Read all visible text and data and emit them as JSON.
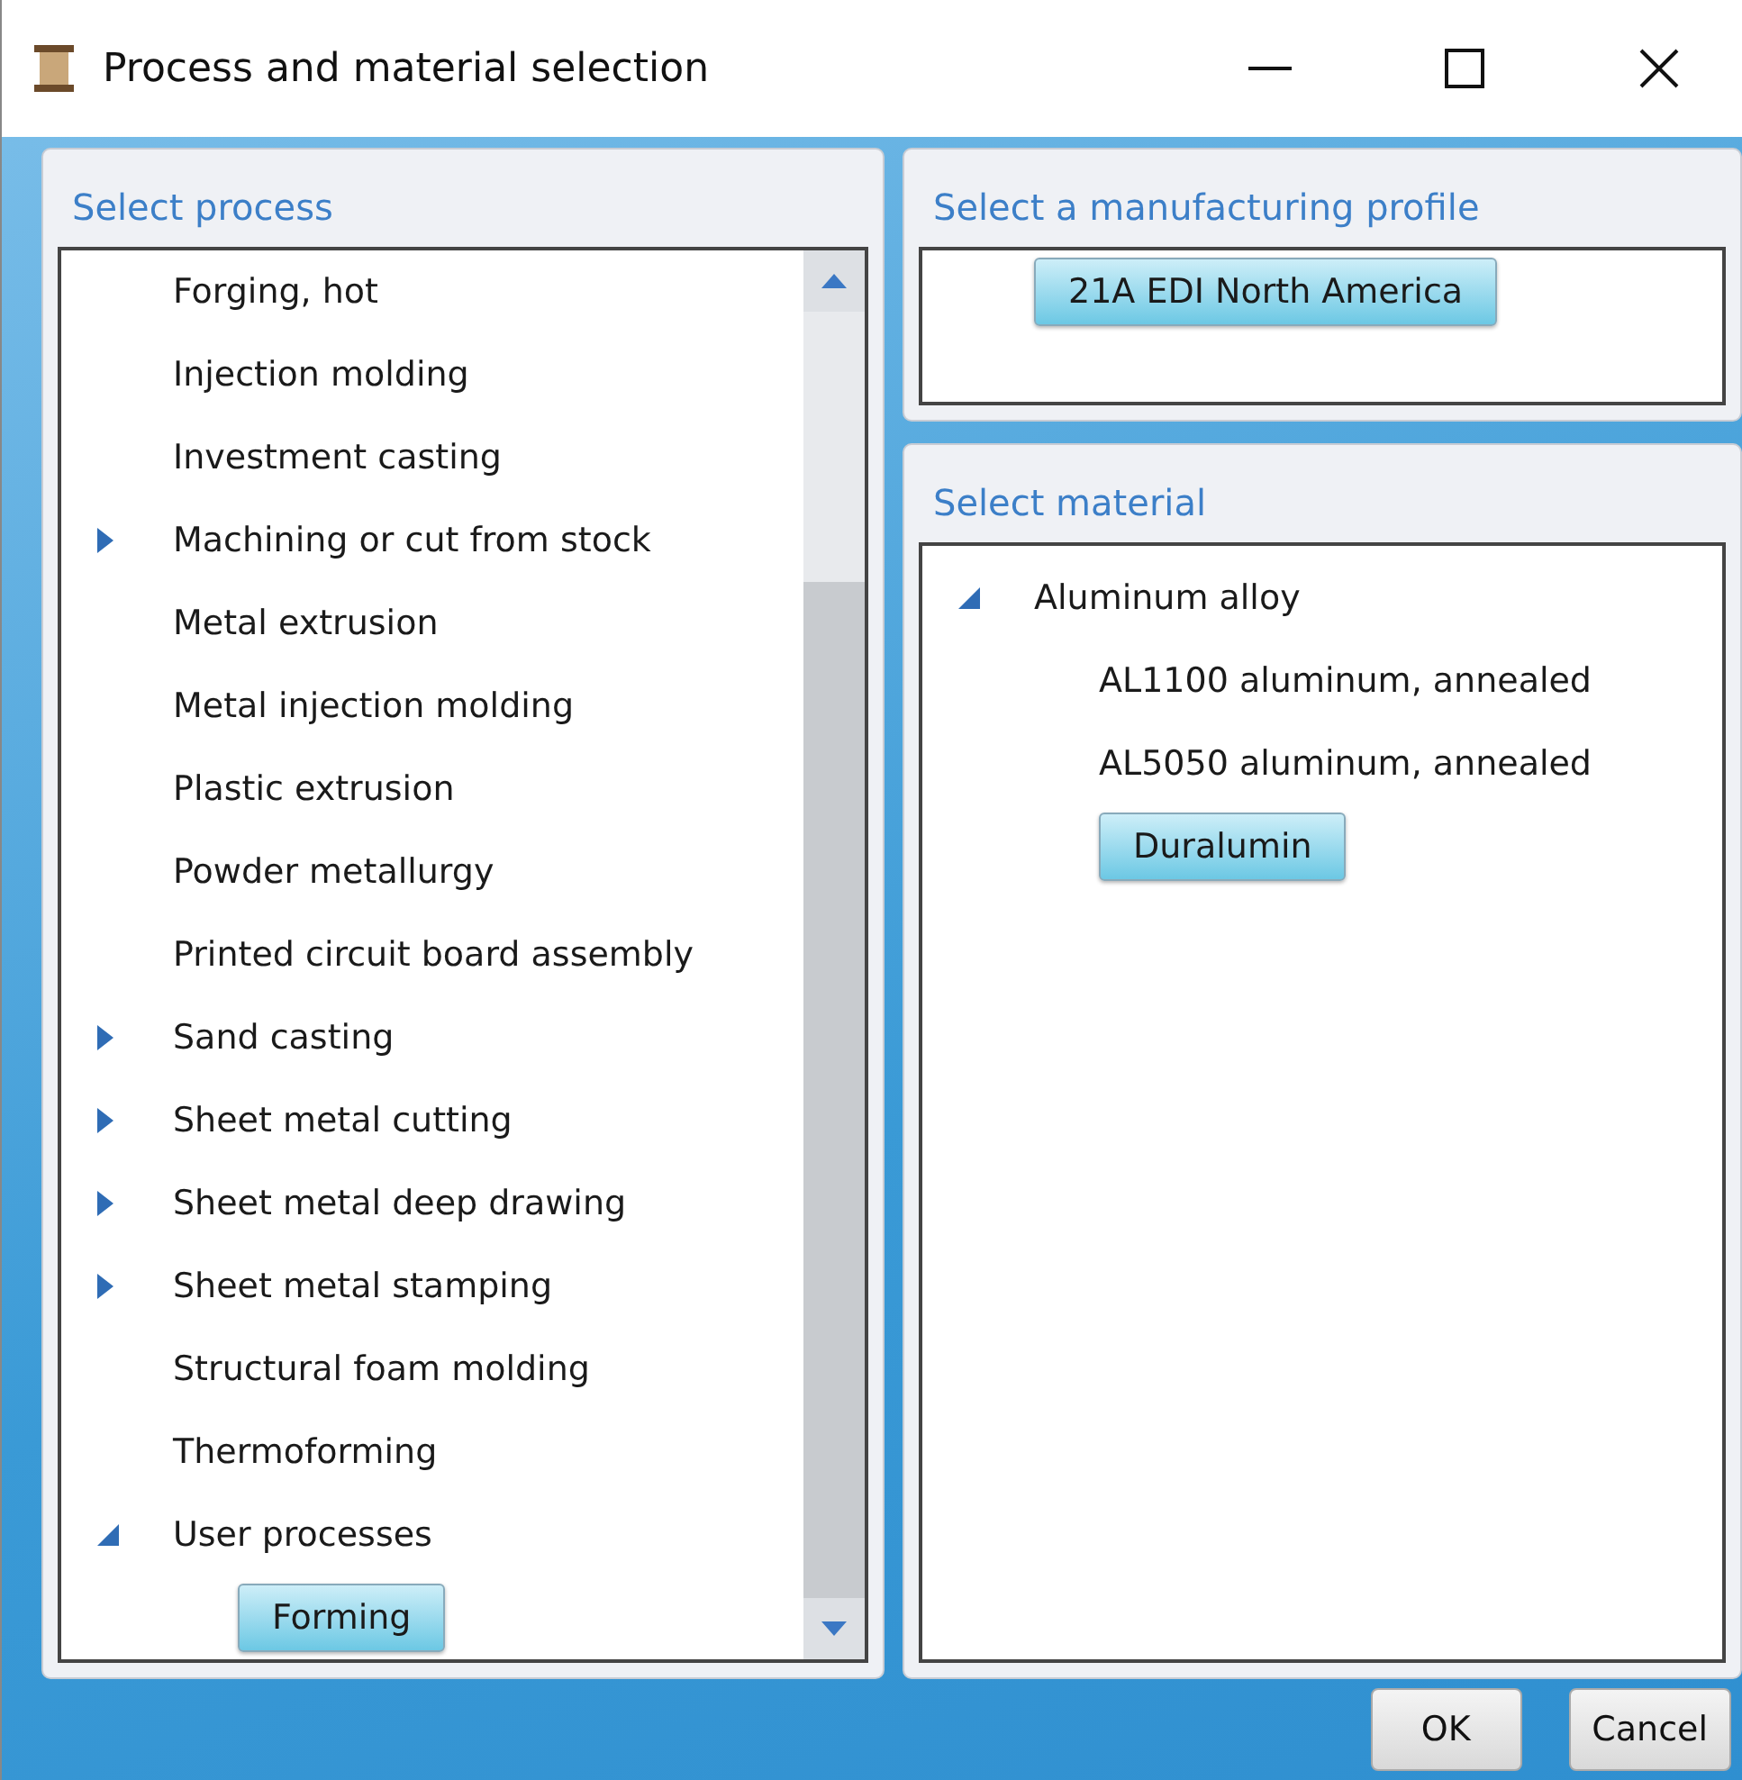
{
  "window": {
    "title": "Process and material selection"
  },
  "process_panel": {
    "title": "Select process",
    "items": [
      {
        "label": "Forging, hot",
        "selected": false
      },
      {
        "label": "Injection molding",
        "selected": false
      },
      {
        "label": "Investment casting",
        "selected": false
      },
      {
        "label": "Machining or cut from stock",
        "expanded": false,
        "selected": false
      },
      {
        "label": "Metal extrusion",
        "selected": false
      },
      {
        "label": "Metal injection molding",
        "selected": false
      },
      {
        "label": "Plastic extrusion",
        "selected": false
      },
      {
        "label": "Powder metallurgy",
        "selected": false
      },
      {
        "label": "Printed circuit board assembly",
        "selected": false
      },
      {
        "label": "Sand casting",
        "expanded": false,
        "selected": false
      },
      {
        "label": "Sheet metal cutting",
        "expanded": false,
        "selected": false
      },
      {
        "label": "Sheet metal deep drawing",
        "expanded": false,
        "selected": false
      },
      {
        "label": "Sheet metal stamping",
        "expanded": false,
        "selected": false
      },
      {
        "label": "Structural foam molding",
        "selected": false
      },
      {
        "label": "Thermoforming",
        "selected": false
      },
      {
        "label": "User processes",
        "expanded": true,
        "selected": false,
        "children": [
          {
            "label": "Forming",
            "selected": true
          }
        ]
      }
    ]
  },
  "profile_panel": {
    "title": "Select a manufacturing profile",
    "items": [
      {
        "label": "21A EDI North America",
        "selected": true
      }
    ]
  },
  "material_panel": {
    "title": "Select material",
    "items": [
      {
        "label": "Aluminum alloy",
        "expanded": true,
        "selected": false,
        "children": [
          {
            "label": "AL1100 aluminum, annealed",
            "selected": false
          },
          {
            "label": "AL5050 aluminum, annealed",
            "selected": false
          },
          {
            "label": "Duralumin",
            "selected": true
          }
        ]
      }
    ]
  },
  "buttons": [
    "OK",
    "Cancel"
  ]
}
